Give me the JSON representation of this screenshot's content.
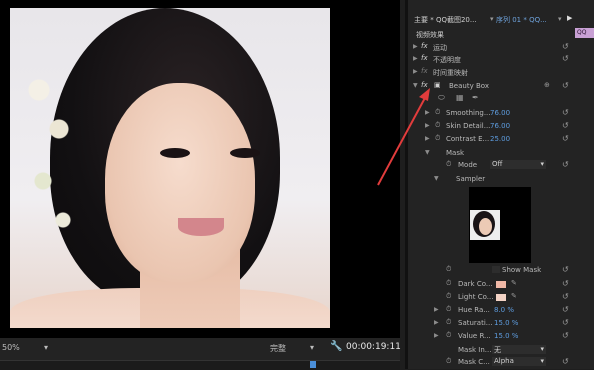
{
  "monitor": {
    "zoom": "50%",
    "quality": "完整",
    "timecode": "00:00:19:11"
  },
  "panel": {
    "source_tab": "主要 * QQ截图20...",
    "sequence_tab": "序列 01 * QQ...",
    "clip_strip_label": "QQ",
    "section_title": "视频效果",
    "effects": [
      {
        "name": "运动"
      },
      {
        "name": "不透明度"
      },
      {
        "name": "时间重映射"
      },
      {
        "name": "Beauty Box"
      }
    ],
    "params": {
      "smoothing": {
        "label": "Smoothing...",
        "value": "76.00"
      },
      "skin_detail": {
        "label": "Skin Detail...",
        "value": "76.00"
      },
      "contrast": {
        "label": "Contrast E...",
        "value": "25.00"
      },
      "mask": {
        "label": "Mask"
      },
      "mode": {
        "label": "Mode",
        "value": "Off"
      },
      "sampler": {
        "label": "Sampler"
      },
      "show_mask": {
        "label": "Show Mask"
      },
      "dark_color": {
        "label": "Dark Co...",
        "color": "#f0b8a6"
      },
      "light_color": {
        "label": "Light Co...",
        "color": "#f3d3c5"
      },
      "hue_range": {
        "label": "Hue Ra...",
        "value": "8.0 %"
      },
      "saturation": {
        "label": "Saturati...",
        "value": "15.0 %"
      },
      "value_range": {
        "label": "Value R...",
        "value": "15.0 %"
      },
      "mask_in": {
        "label": "Mask In...",
        "value": "无"
      },
      "mask_co": {
        "label": "Mask C...",
        "value": "Alpha"
      }
    }
  },
  "colors": {
    "accent_blue": "#5e9de0",
    "annotation_red": "#e23c3c"
  }
}
